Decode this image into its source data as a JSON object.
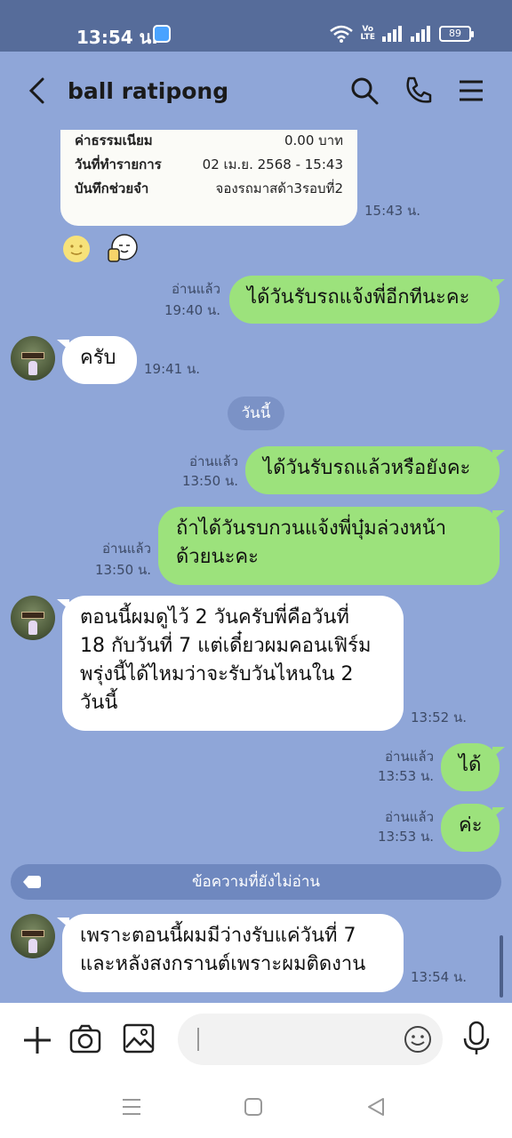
{
  "status_bar": {
    "time": "13:54 น.",
    "volte_top": "Vo",
    "volte_bottom": "LTE",
    "battery": "89"
  },
  "header": {
    "contact_name": "ball ratipong"
  },
  "receipt": {
    "rows": [
      {
        "label": "ค่าธรรมเนียม",
        "value": "0.00 บาท"
      },
      {
        "label": "วันที่ทำรายการ",
        "value": "02 เม.ย. 2568 - 15:43"
      },
      {
        "label": "บันทึกช่วยจำ",
        "value": "จองรถมาสด้า3รอบที่2"
      }
    ],
    "time": "15:43 น."
  },
  "messages": [
    {
      "dir": "out",
      "text": "ได้วันรับรถแจ้งพี่อีกทีนะคะ",
      "read": "อ่านแล้ว",
      "time": "19:40 น."
    },
    {
      "dir": "in",
      "text": "ครับ",
      "time": "19:41 น."
    },
    {
      "dir": "out",
      "text": "ได้วันรับรถแล้วหรือยังคะ",
      "read": "อ่านแล้ว",
      "time": "13:50 น."
    },
    {
      "dir": "out",
      "text_lines": [
        "ถ้าได้วันรบกวนแจ้งพี่บุ๋มล่วงหน้า",
        "ด้วยนะคะ"
      ],
      "read": "อ่านแล้ว",
      "time": "13:50 น."
    },
    {
      "dir": "in",
      "text_lines": [
        "ตอนนี้ผมดูไว้ 2 วันครับพี่คือวันที่",
        "18 กับวันที่ 7 แต่เดี๋ยวผมคอนเฟิร์ม",
        "พรุ่งนี้ได้ไหมว่าจะรับวันไหนใน 2",
        "วันนี้"
      ],
      "time": "13:52 น."
    },
    {
      "dir": "out",
      "text": "ได้",
      "read": "อ่านแล้ว",
      "time": "13:53 น."
    },
    {
      "dir": "out",
      "text": "ค่ะ",
      "read": "อ่านแล้ว",
      "time": "13:53 น."
    },
    {
      "dir": "in",
      "text_lines": [
        "เพราะตอนนี้ผมมีว่างรับแค่วันที่ 7",
        "และหลังสงกรานต์เพราะผมติดงาน"
      ],
      "time": "13:54 น."
    }
  ],
  "day_divider": "วันนี้",
  "unread_divider": "ข้อความที่ยังไม่อ่าน",
  "composer": {
    "value": ""
  },
  "icons": {
    "back": "back-arrow-icon",
    "search": "search-icon",
    "call": "phone-icon",
    "menu": "menu-icon",
    "plus": "plus-icon",
    "camera": "camera-icon",
    "gallery": "image-icon",
    "emoji": "emoji-icon",
    "mic": "microphone-icon"
  },
  "colors": {
    "chat_bg": "#8fa6d8",
    "outgoing_bubble": "#9ce27c",
    "incoming_bubble": "#ffffff",
    "status_bar": "#566c9a"
  }
}
